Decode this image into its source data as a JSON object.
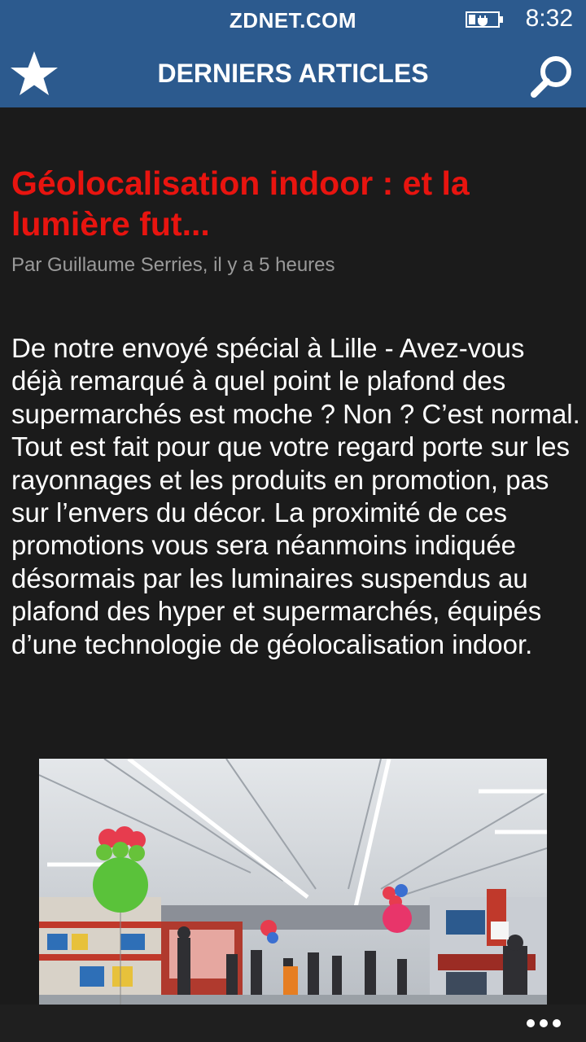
{
  "status_bar": {
    "title": "ZDNET.COM",
    "time": "8:32",
    "battery_icon": "battery-charging-icon"
  },
  "app_bar": {
    "title": "DERNIERS ARTICLES",
    "left_icon": "star-icon",
    "right_icon": "search-icon",
    "color": "#2c5a8e"
  },
  "article": {
    "title": "Géolocalisation indoor : et la lumière fut...",
    "byline": "Par Guillaume Serries, il y a 5 heures",
    "body": "De notre envoyé spécial à Lille - Avez-vous déjà remarqué à quel point le plafond des supermarchés est moche ? Non ? C’est normal. Tout est fait pour que votre regard porte sur les rayonnages et les produits en promotion, pas sur l’envers du décor. La proximité de ces promotions vous sera néanmoins indiquée désormais par les luminaires suspendus au plafond des hyper et supermarchés, équipés d’une technologie de géolocalisation indoor.",
    "title_color": "#e8140f"
  },
  "bottom_bar": {
    "more_icon": "more-dots-icon"
  }
}
